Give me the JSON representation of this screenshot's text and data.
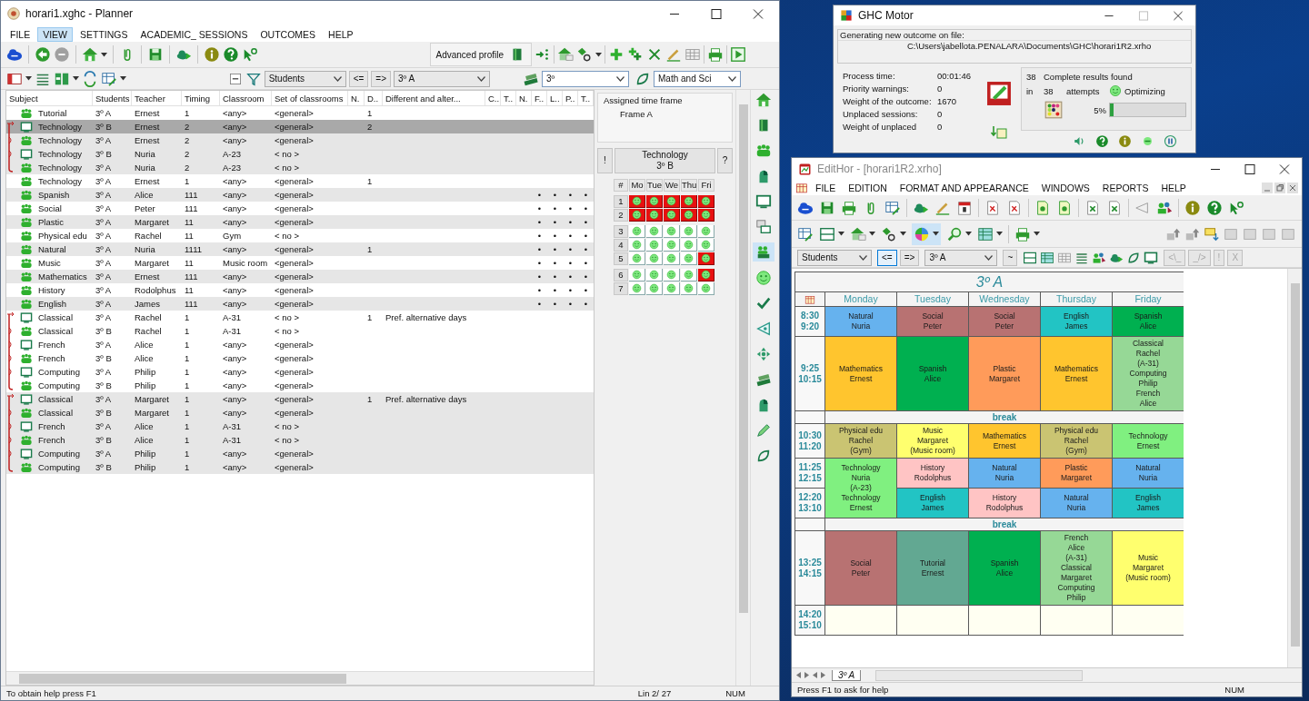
{
  "planner": {
    "title": "horari1.xghc - Planner",
    "menu": [
      {
        "label": "FILE",
        "selected": false
      },
      {
        "label": "VIEW",
        "selected": true
      },
      {
        "label": "SETTINGS",
        "selected": false
      },
      {
        "label": "ACADEMIC_ SESSIONS",
        "selected": false
      },
      {
        "label": "OUTCOMES",
        "selected": false
      },
      {
        "label": "HELP",
        "selected": false
      }
    ],
    "profile_button": "Advanced profile",
    "filter": {
      "category": "Students",
      "arrows": [
        {
          "label": "<=",
          "selected": false
        },
        {
          "label": "=>",
          "selected": false
        }
      ],
      "group": "3º A",
      "level": "3º",
      "area": "Math and Sci"
    },
    "columns": [
      "Subject",
      "Students",
      "Teacher",
      "Timing",
      "Classroom",
      "Set of classrooms",
      "N.",
      "D..",
      "Different and alter...",
      "C..",
      "T..",
      "N.",
      "F..",
      "L..",
      "P..",
      "T.."
    ],
    "groups": [
      {
        "linked": false,
        "rows": [
          {
            "subject": "Tutorial",
            "students": "3º A",
            "teacher": "Ernest",
            "timing": "1",
            "classroom": "<any>",
            "set": "<general>",
            "d": "1",
            "kind": "whole",
            "shaded": false,
            "selected": false
          }
        ]
      },
      {
        "linked": true,
        "rows": [
          {
            "subject": "Technology",
            "students": "3º B",
            "teacher": "Ernest",
            "timing": "2",
            "classroom": "<any>",
            "set": "<general>",
            "d": "2",
            "kind": "part",
            "shaded": true,
            "selected": true
          },
          {
            "subject": "Technology",
            "students": "3º A",
            "teacher": "Ernest",
            "timing": "2",
            "classroom": "<any>",
            "set": "<general>",
            "kind": "whole",
            "shaded": true,
            "selected": false
          },
          {
            "subject": "Technology",
            "students": "3º B",
            "teacher": "Nuria",
            "timing": "2",
            "classroom": "A-23",
            "set": "< no >",
            "kind": "part",
            "shaded": true,
            "selected": false
          },
          {
            "subject": "Technology",
            "students": "3º A",
            "teacher": "Nuria",
            "timing": "2",
            "classroom": "A-23",
            "set": "< no >",
            "kind": "whole",
            "shaded": true,
            "selected": false
          }
        ]
      },
      {
        "linked": false,
        "rows": [
          {
            "subject": "Technology",
            "students": "3º A",
            "teacher": "Ernest",
            "timing": "1",
            "classroom": "<any>",
            "set": "<general>",
            "d": "1",
            "kind": "whole",
            "shaded": false,
            "selected": false
          },
          {
            "subject": "Spanish",
            "students": "3º A",
            "teacher": "Alice",
            "timing": "111",
            "classroom": "<any>",
            "set": "<general>",
            "marks": [
              "•",
              "•",
              "•",
              "•"
            ],
            "kind": "whole",
            "shaded": true,
            "selected": false
          },
          {
            "subject": "Social",
            "students": "3º A",
            "teacher": "Peter",
            "timing": "111",
            "classroom": "<any>",
            "set": "<general>",
            "marks": [
              "•",
              "•",
              "•",
              "•"
            ],
            "kind": "whole",
            "shaded": false,
            "selected": false
          },
          {
            "subject": "Plastic",
            "students": "3º A",
            "teacher": "Margaret",
            "timing": "11",
            "classroom": "<any>",
            "set": "<general>",
            "marks": [
              "•",
              "•",
              "•",
              "•"
            ],
            "kind": "whole",
            "shaded": true,
            "selected": false
          },
          {
            "subject": "Physical edu",
            "students": "3º A",
            "teacher": "Rachel",
            "timing": "11",
            "classroom": "Gym",
            "set": "< no >",
            "marks": [
              "•",
              "•",
              "•",
              "•"
            ],
            "kind": "whole",
            "shaded": false,
            "selected": false
          },
          {
            "subject": "Natural",
            "students": "3º A",
            "teacher": "Nuria",
            "timing": "1111",
            "classroom": "<any>",
            "set": "<general>",
            "d": "1",
            "marks": [
              "•",
              "•",
              "•",
              "•"
            ],
            "kind": "whole",
            "shaded": true,
            "selected": false
          },
          {
            "subject": "Music",
            "students": "3º A",
            "teacher": "Margaret",
            "timing": "11",
            "classroom": "Music room",
            "set": "<general>",
            "marks": [
              "•",
              "•",
              "•",
              "•"
            ],
            "kind": "whole",
            "shaded": false,
            "selected": false
          },
          {
            "subject": "Mathematics",
            "students": "3º A",
            "teacher": "Ernest",
            "timing": "111",
            "classroom": "<any>",
            "set": "<general>",
            "marks": [
              "•",
              "•",
              "•",
              "•"
            ],
            "kind": "whole",
            "shaded": true,
            "selected": false
          },
          {
            "subject": "History",
            "students": "3º A",
            "teacher": "Rodolphus",
            "timing": "11",
            "classroom": "<any>",
            "set": "<general>",
            "marks": [
              "•",
              "•",
              "•",
              "•"
            ],
            "kind": "whole",
            "shaded": false,
            "selected": false
          },
          {
            "subject": "English",
            "students": "3º A",
            "teacher": "James",
            "timing": "111",
            "classroom": "<any>",
            "set": "<general>",
            "marks": [
              "•",
              "•",
              "•",
              "•"
            ],
            "kind": "whole",
            "shaded": true,
            "selected": false
          }
        ]
      },
      {
        "linked": true,
        "rows": [
          {
            "subject": "Classical",
            "students": "3º A",
            "teacher": "Rachel",
            "timing": "1",
            "classroom": "A-31",
            "set": "< no >",
            "d": "1",
            "different": "Pref. alternative days",
            "kind": "part",
            "shaded": false,
            "selected": false
          },
          {
            "subject": "Classical",
            "students": "3º B",
            "teacher": "Rachel",
            "timing": "1",
            "classroom": "A-31",
            "set": "< no >",
            "kind": "whole",
            "shaded": false,
            "selected": false
          },
          {
            "subject": "French",
            "students": "3º A",
            "teacher": "Alice",
            "timing": "1",
            "classroom": "<any>",
            "set": "<general>",
            "kind": "part",
            "shaded": false,
            "selected": false
          },
          {
            "subject": "French",
            "students": "3º B",
            "teacher": "Alice",
            "timing": "1",
            "classroom": "<any>",
            "set": "<general>",
            "kind": "whole",
            "shaded": false,
            "selected": false
          },
          {
            "subject": "Computing",
            "students": "3º A",
            "teacher": "Philip",
            "timing": "1",
            "classroom": "<any>",
            "set": "<general>",
            "kind": "part",
            "shaded": false,
            "selected": false
          },
          {
            "subject": "Computing",
            "students": "3º B",
            "teacher": "Philip",
            "timing": "1",
            "classroom": "<any>",
            "set": "<general>",
            "kind": "whole",
            "shaded": false,
            "selected": false
          }
        ]
      },
      {
        "linked": true,
        "rows": [
          {
            "subject": "Classical",
            "students": "3º A",
            "teacher": "Margaret",
            "timing": "1",
            "classroom": "<any>",
            "set": "<general>",
            "d": "1",
            "different": "Pref. alternative days",
            "kind": "part",
            "shaded": true,
            "selected": false
          },
          {
            "subject": "Classical",
            "students": "3º B",
            "teacher": "Margaret",
            "timing": "1",
            "classroom": "<any>",
            "set": "<general>",
            "kind": "whole",
            "shaded": true,
            "selected": false
          },
          {
            "subject": "French",
            "students": "3º A",
            "teacher": "Alice",
            "timing": "1",
            "classroom": "A-31",
            "set": "< no >",
            "kind": "part",
            "shaded": true,
            "selected": false
          },
          {
            "subject": "French",
            "students": "3º B",
            "teacher": "Alice",
            "timing": "1",
            "classroom": "A-31",
            "set": "< no >",
            "kind": "whole",
            "shaded": true,
            "selected": false
          },
          {
            "subject": "Computing",
            "students": "3º A",
            "teacher": "Philip",
            "timing": "1",
            "classroom": "<any>",
            "set": "<general>",
            "kind": "part",
            "shaded": true,
            "selected": false
          },
          {
            "subject": "Computing",
            "students": "3º B",
            "teacher": "Philip",
            "timing": "1",
            "classroom": "<any>",
            "set": "<general>",
            "kind": "whole",
            "shaded": true,
            "selected": false
          }
        ]
      }
    ],
    "frame_panel": {
      "label": "Assigned time frame",
      "value": "Frame A"
    },
    "session": {
      "warn": "!",
      "title": "Technology",
      "subtitle": "3º B",
      "help": "?"
    },
    "grid": {
      "corner": "#",
      "days": [
        "Mo",
        "Tue",
        "We",
        "Thu",
        "Fri"
      ],
      "groups": [
        {
          "periods": [
            {
              "number": "1",
              "blocked": [
                true,
                true,
                true,
                true,
                true
              ]
            },
            {
              "number": "2",
              "blocked": [
                true,
                true,
                true,
                true,
                true
              ]
            }
          ]
        },
        {
          "periods": [
            {
              "number": "3",
              "blocked": [
                false,
                false,
                false,
                false,
                false
              ]
            },
            {
              "number": "4",
              "blocked": [
                false,
                false,
                false,
                false,
                false
              ]
            },
            {
              "number": "5",
              "blocked": [
                false,
                false,
                false,
                false,
                true
              ]
            }
          ]
        },
        {
          "periods": [
            {
              "number": "6",
              "blocked": [
                false,
                false,
                false,
                false,
                true
              ]
            },
            {
              "number": "7",
              "blocked": [
                false,
                false,
                false,
                false,
                false
              ]
            }
          ]
        }
      ]
    },
    "status": {
      "help": "To obtain help press F1",
      "line": "Lin 2/ 27",
      "mode": "NUM"
    }
  },
  "motor": {
    "title": "GHC Motor",
    "file_label": "Generating new outcome on file:",
    "file_path": "C:\\Users\\jabellota.PENALARA\\Documents\\GHC\\horari1R2.xrho",
    "stats": [
      {
        "label": "Process time:",
        "value": "00:01:46"
      },
      {
        "label": "Priority warnings:",
        "value": "0"
      },
      {
        "label": "Weight of the outcome:",
        "value": "1670"
      },
      {
        "label": "Unplaced sessions:",
        "value": "0"
      },
      {
        "label": "Weight of unplaced",
        "value": "0"
      }
    ],
    "results": {
      "found": "38",
      "found_label": "Complete results found",
      "in": "in",
      "attempts": "38",
      "attempts_label": "attempts",
      "state": "Optimizing",
      "percent": "5%",
      "level": 0.05
    }
  },
  "editor": {
    "title": "EditHor - [horari1R2.xrho]",
    "menu": [
      "FILE",
      "EDITION",
      "FORMAT AND APPEARANCE",
      "WINDOWS",
      "REPORTS",
      "HELP"
    ],
    "filter": {
      "category": "Students",
      "arrows": [
        {
          "label": "<=",
          "selected": true
        },
        {
          "label": "=>",
          "selected": false
        }
      ],
      "group": "3º A",
      "tilde": "~",
      "buttons": [
        {
          "label": "<\\_",
          "disabled": true
        },
        {
          "label": "_/>",
          "disabled": true
        },
        {
          "label": "!",
          "disabled": true
        },
        {
          "label": "X",
          "disabled": true
        }
      ]
    },
    "timetable": {
      "title": "3º A",
      "days": [
        "Monday",
        "Tuesday",
        "Wednesday",
        "Thursday",
        "Friday"
      ],
      "slots": [
        {
          "kind": "period",
          "start": "8:30",
          "end": "9:20",
          "cells": [
            {
              "lines": [
                "Natural",
                "Nuria"
              ],
              "color": "#66b2ee"
            },
            {
              "lines": [
                "Social",
                "Peter"
              ],
              "color": "#b87272"
            },
            {
              "lines": [
                "Social",
                "Peter"
              ],
              "color": "#b87272"
            },
            {
              "lines": [
                "English",
                "James"
              ],
              "color": "#22c4c4"
            },
            {
              "lines": [
                "Spanish",
                "Alice"
              ],
              "color": "#00b050"
            }
          ]
        },
        {
          "kind": "period",
          "start": "9:25",
          "end": "10:15",
          "cells": [
            {
              "lines": [
                "Mathematics",
                "Ernest"
              ],
              "color": "#ffc52e"
            },
            {
              "lines": [
                "Spanish",
                "Alice"
              ],
              "color": "#00b050"
            },
            {
              "lines": [
                "Plastic",
                "Margaret"
              ],
              "color": "#ff9b5a"
            },
            {
              "lines": [
                "Mathematics",
                "Ernest"
              ],
              "color": "#ffc52e"
            },
            {
              "lines": [
                "Classical",
                "Rachel",
                "(A-31)",
                "Computing",
                "Philip",
                "French",
                "Alice"
              ],
              "color": "#96d896"
            }
          ]
        },
        {
          "kind": "break",
          "label": "break"
        },
        {
          "kind": "period",
          "start": "10:30",
          "end": "11:20",
          "cells": [
            {
              "lines": [
                "Physical edu",
                "Rachel",
                "(Gym)"
              ],
              "color": "#cac472"
            },
            {
              "lines": [
                "Music",
                "Margaret",
                "(Music room)"
              ],
              "color": "#ffff6e"
            },
            {
              "lines": [
                "Mathematics",
                "Ernest"
              ],
              "color": "#ffc52e"
            },
            {
              "lines": [
                "Physical edu",
                "Rachel",
                "(Gym)"
              ],
              "color": "#cac472"
            },
            {
              "lines": [
                "Technology",
                "Ernest"
              ],
              "color": "#80f080"
            }
          ]
        },
        {
          "kind": "period",
          "start": "11:25",
          "end": "12:15",
          "cells": [
            {
              "lines": [
                "Technology",
                "Nuria",
                "(A-23)",
                "Technology",
                "Ernest"
              ],
              "color": "#80f080"
            },
            {
              "lines": [
                "History",
                "Rodolphus"
              ],
              "color": "#ffc4c4"
            },
            {
              "lines": [
                "Natural",
                "Nuria"
              ],
              "color": "#66b2ee"
            },
            {
              "lines": [
                "Plastic",
                "Margaret"
              ],
              "color": "#ff9b5a"
            },
            {
              "lines": [
                "Natural",
                "Nuria"
              ],
              "color": "#66b2ee"
            }
          ]
        },
        {
          "kind": "period",
          "start": "12:20",
          "end": "13:10",
          "cells": [
            {
              "lines": [
                "English",
                "James"
              ],
              "color": "#22c4c4"
            },
            {
              "lines": [
                "History",
                "Rodolphus"
              ],
              "color": "#ffc4c4"
            },
            {
              "lines": [
                "Natural",
                "Nuria"
              ],
              "color": "#66b2ee"
            },
            {
              "lines": [
                "English",
                "James"
              ],
              "color": "#22c4c4"
            }
          ]
        },
        {
          "kind": "break",
          "label": "break"
        },
        {
          "kind": "period",
          "start": "13:25",
          "end": "14:15",
          "cells": [
            {
              "lines": [
                "Social",
                "Peter"
              ],
              "color": "#b87272"
            },
            {
              "lines": [
                "Tutorial",
                "Ernest"
              ],
              "color": "#62a892"
            },
            {
              "lines": [
                "Spanish",
                "Alice"
              ],
              "color": "#00b050"
            },
            {
              "lines": [
                "French",
                "Alice",
                "(A-31)",
                "Classical",
                "Margaret",
                "Computing",
                "Philip"
              ],
              "color": "#96d896"
            },
            {
              "lines": [
                "Music",
                "Margaret",
                "(Music room)"
              ],
              "color": "#ffff6e"
            }
          ]
        },
        {
          "kind": "period",
          "start": "14:20",
          "end": "15:10",
          "cells": [
            {
              "color": "#fffff2"
            },
            {
              "color": "#fffff2"
            },
            {
              "color": "#fffff2"
            },
            {
              "color": "#fffff2"
            },
            {
              "color": "#fffff2"
            }
          ]
        }
      ]
    },
    "tab": "3º A",
    "status": {
      "help": "Press F1 to ask for help",
      "mode": "NUM"
    }
  }
}
